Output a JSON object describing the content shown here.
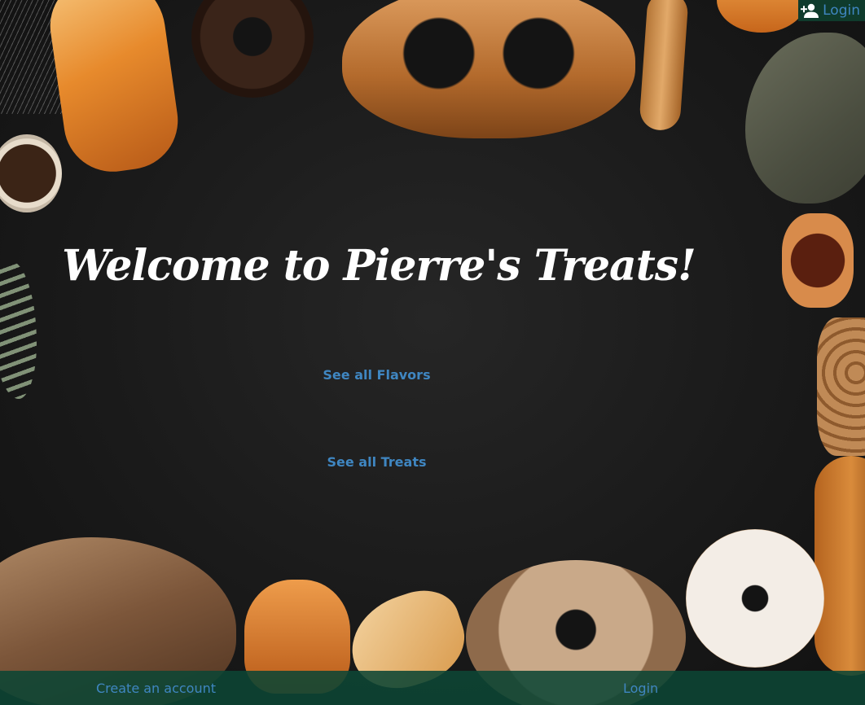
{
  "header": {
    "login_label": "Login",
    "login_icon": "person-add-icon"
  },
  "main": {
    "title": "Welcome to Pierre's Treats!",
    "links": [
      {
        "label": "See all Flavors"
      },
      {
        "label": "See all Treats"
      }
    ]
  },
  "footer": {
    "create_account_label": "Create an account",
    "login_label": "Login"
  },
  "colors": {
    "link": "#3f86c1",
    "footer_bg": "#0d4634",
    "header_login_bg": "#0f3b2c",
    "background": "#1a1a1a"
  }
}
